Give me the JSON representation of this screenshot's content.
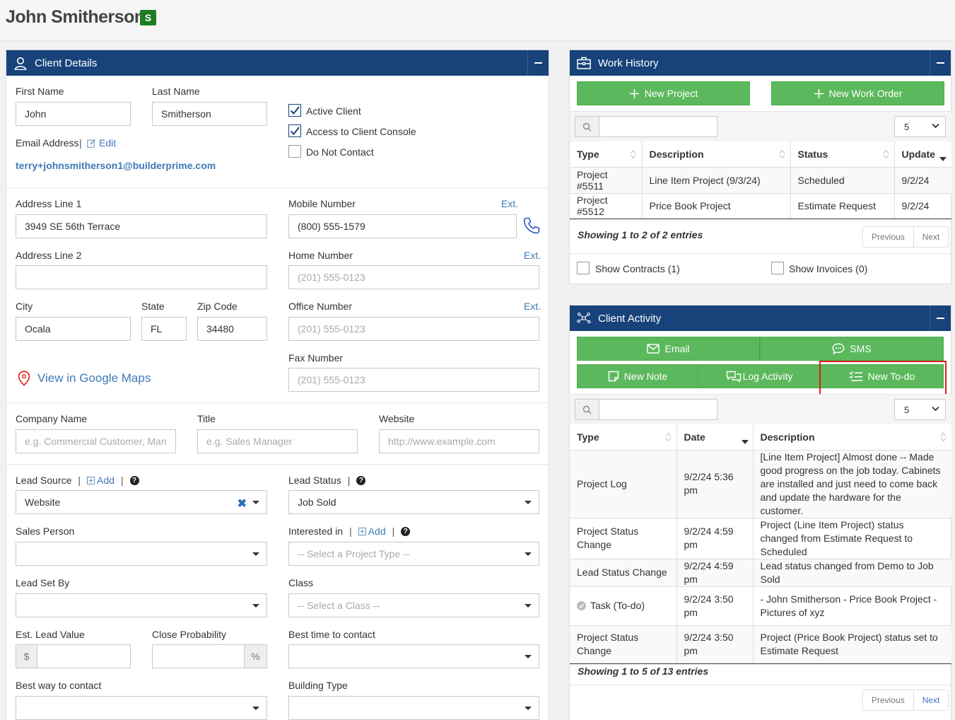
{
  "header": {
    "name": "John Smitherson",
    "badge": "S"
  },
  "client_details": {
    "title": "Client Details",
    "first_name_label": "First Name",
    "first_name": "John",
    "last_name_label": "Last Name",
    "last_name": "Smitherson",
    "email_label": "Email Address",
    "edit_label": "Edit",
    "email": "terry+johnsmitherson1@builderprime.com",
    "active_client_label": "Active Client",
    "active_client": true,
    "console_label": "Access to Client Console",
    "console": true,
    "do_not_contact_label": "Do Not Contact",
    "do_not_contact": false,
    "address1_label": "Address Line 1",
    "address1": "3949 SE 56th Terrace",
    "address2_label": "Address Line 2",
    "address2": "",
    "city_label": "City",
    "city": "Ocala",
    "state_label": "State",
    "state": "FL",
    "zip_label": "Zip Code",
    "zip": "34480",
    "maps_label": "View in Google Maps",
    "mobile_label": "Mobile Number",
    "mobile": "(800) 555-1579",
    "home_label": "Home Number",
    "office_label": "Office Number",
    "fax_label": "Fax Number",
    "ext_label": "Ext.",
    "phone_placeholder": "(201) 555-0123",
    "company_label": "Company Name",
    "company_placeholder": "e.g. Commercial Customer, Man",
    "title_label": "Title",
    "title_placeholder": "e.g. Sales Manager",
    "website_label": "Website",
    "website_placeholder": "http://www.example.com",
    "lead_source_label": "Lead Source",
    "add_label": "Add",
    "lead_source": "Website",
    "lead_status_label": "Lead Status",
    "lead_status": "Job Sold",
    "sales_person_label": "Sales Person",
    "interested_label": "Interested in",
    "project_type_placeholder": "-- Select a Project Type --",
    "lead_set_by_label": "Lead Set By",
    "class_label": "Class",
    "class_placeholder": "-- Select a Class --",
    "lead_value_label": "Est. Lead Value",
    "currency_symbol": "$",
    "close_prob_label": "Close Probability",
    "percent_symbol": "%",
    "best_time_label": "Best time to contact",
    "best_way_label": "Best way to contact",
    "building_type_label": "Building Type"
  },
  "work_history": {
    "title": "Work History",
    "new_project_label": "New Project",
    "new_work_order_label": "New Work Order",
    "page_size": "5",
    "columns": [
      "Type",
      "Description",
      "Status",
      "Update"
    ],
    "rows": [
      [
        "Project #5511",
        "Line Item Project (9/3/24)",
        "Scheduled",
        "9/2/24"
      ],
      [
        "Project #5512",
        "Price Book Project",
        "Estimate Request",
        "9/2/24"
      ]
    ],
    "info": "Showing 1 to 2 of 2 entries",
    "previous_label": "Previous",
    "next_label": "Next",
    "show_contracts_label": "Show Contracts (1)",
    "show_invoices_label": "Show Invoices (0)"
  },
  "client_activity": {
    "title": "Client Activity",
    "email_label": "Email",
    "sms_label": "SMS",
    "new_note_label": "New Note",
    "log_activity_label": "Log Activity",
    "new_todo_label": "New To-do",
    "page_size": "5",
    "columns": [
      "Type",
      "Date",
      "Description"
    ],
    "rows": [
      {
        "type": "Project Log",
        "date": "9/2/24 5:36 pm",
        "description": "[Line Item Project] Almost done -- Made good progress on the job today. Cabinets are installed and just need to come back and update the hardware for the customer."
      },
      {
        "type": "Project Status Change",
        "date": "9/2/24 4:59 pm",
        "description": "Project (Line Item Project) status changed from Estimate Request to Scheduled"
      },
      {
        "type": "Lead Status Change",
        "date": "9/2/24 4:59 pm",
        "description": "Lead status changed from Demo to Job Sold"
      },
      {
        "type": "Task (To-do)",
        "date": "9/2/24 3:50 pm",
        "description": "- John Smitherson - Price Book Project - Pictures of xyz"
      },
      {
        "type": "Project Status Change",
        "date": "9/2/24 3:50 pm",
        "description": "Project (Price Book Project) status set to Estimate Request"
      }
    ],
    "info": "Showing 1 to 5 of 13 entries",
    "previous_label": "Previous",
    "next_label": "Next"
  }
}
